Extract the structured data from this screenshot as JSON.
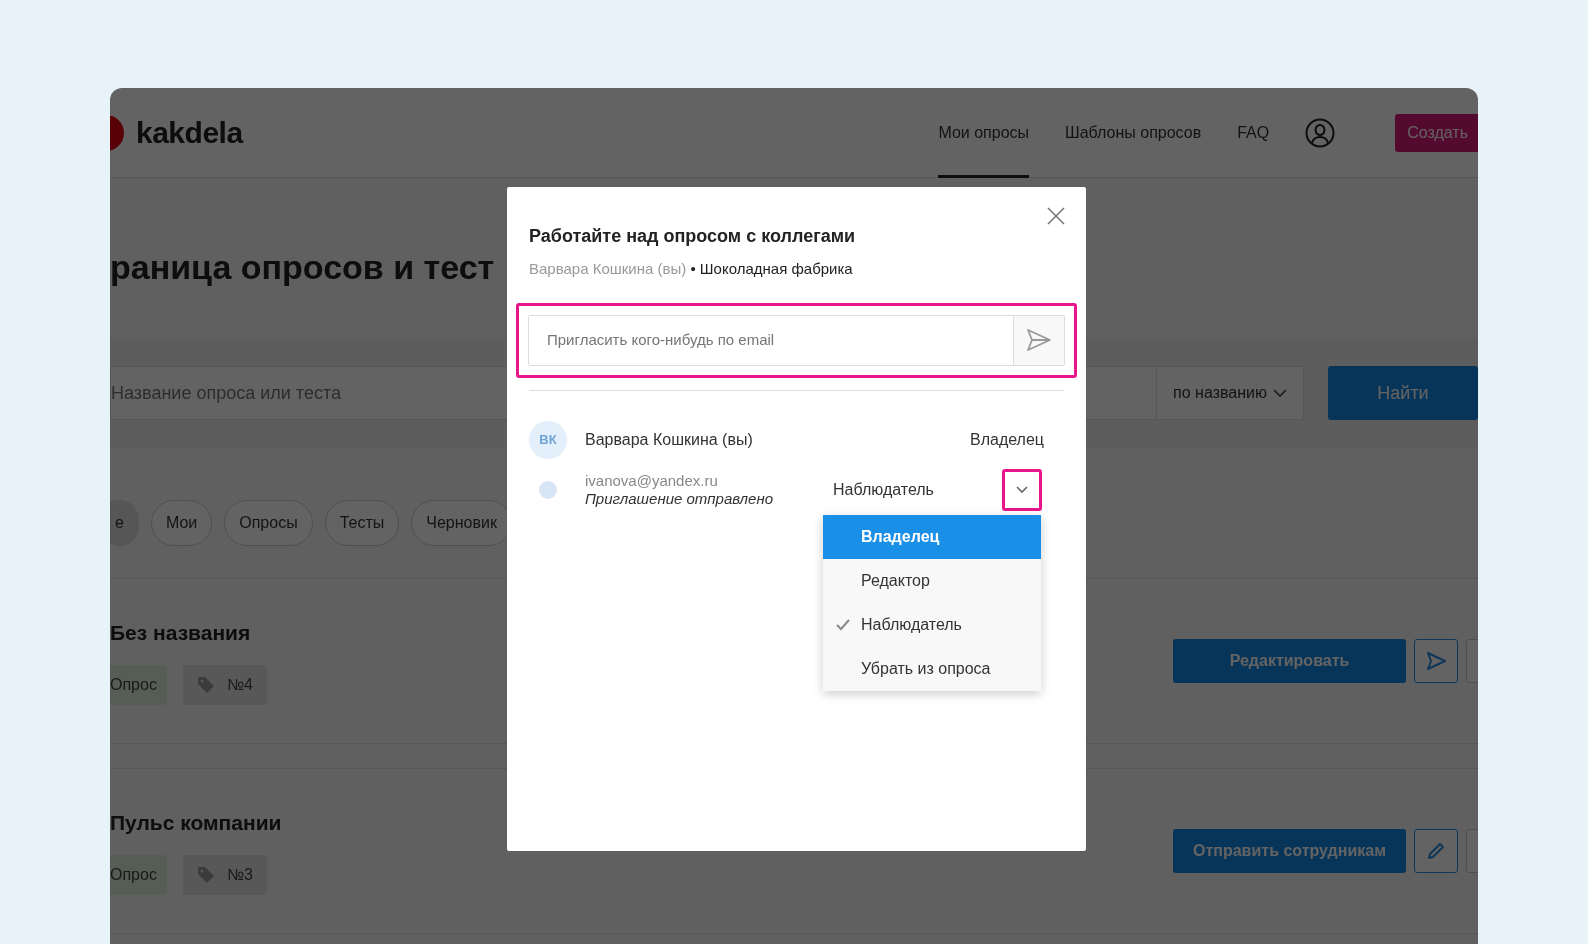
{
  "header": {
    "logo": "kakdela",
    "nav": [
      {
        "label": "Мои опросы",
        "selected": true
      },
      {
        "label": "Шаблоны опросов",
        "selected": false
      },
      {
        "label": "FAQ",
        "selected": false
      }
    ],
    "create_button": "Создать"
  },
  "page_title": "раница опросов и тест",
  "search": {
    "placeholder": "Название опроса или теста",
    "sort": "по названию",
    "button": "Найти"
  },
  "filters": [
    {
      "label": "е",
      "selected": true
    },
    {
      "label": "Мои",
      "selected": false
    },
    {
      "label": "Опросы",
      "selected": false
    },
    {
      "label": "Тесты",
      "selected": false
    },
    {
      "label": "Черновик",
      "selected": false
    }
  ],
  "surveys": [
    {
      "title": "Без названия",
      "type_tag": "Опрос",
      "number_tag": "№4",
      "primary_button": "Редактировать",
      "kind": "send"
    },
    {
      "title": "Пульс компании",
      "type_tag": "Опрос",
      "number_tag": "№3",
      "primary_button": "Отправить сотрудникам",
      "kind": "edit"
    }
  ],
  "dialog": {
    "title": "Работайте над опросом с коллегами",
    "subtitle_user": "Варвара Кошкина (вы)",
    "subtitle_project": "• Шоколадная фабрика",
    "invite": {
      "placeholder": "Пригласить кого-нибудь по email"
    },
    "members": [
      {
        "kind": "user",
        "initials": "ВК",
        "name": "Варвара Кошкина (вы)",
        "role": "Владелец"
      },
      {
        "kind": "invite",
        "email": "ivanova@yandex.ru",
        "status": "Приглашение отправлено",
        "role": "Наблюдатель",
        "expanded": true
      }
    ],
    "role_menu": [
      {
        "label": "Владелец",
        "highlighted": true,
        "checked": false
      },
      {
        "label": "Редактор",
        "highlighted": false,
        "checked": false
      },
      {
        "label": "Наблюдатель",
        "highlighted": false,
        "checked": true
      },
      {
        "label": "Убрать из опроса",
        "highlighted": false,
        "checked": false
      }
    ]
  }
}
